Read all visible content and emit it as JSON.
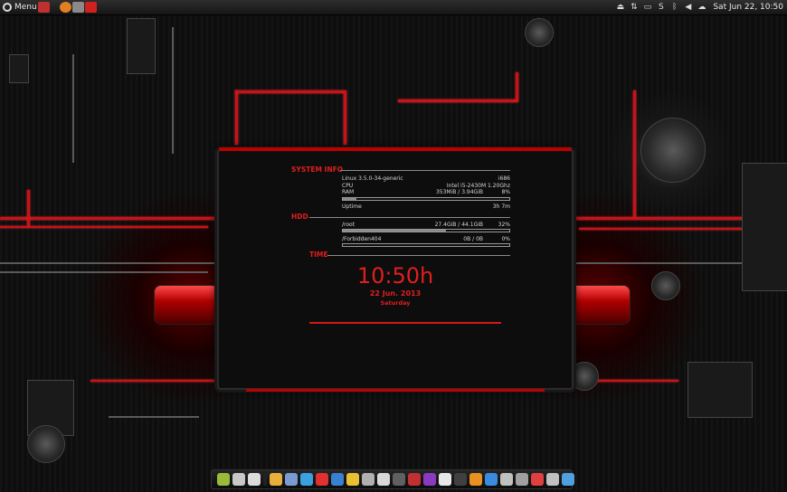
{
  "panel": {
    "menu_label": "Menu",
    "clock": "Sat Jun 22, 10:50",
    "tray_icons": [
      "eject-icon",
      "arrow-up-icon",
      "battery-icon",
      "skype-icon",
      "bluetooth-icon",
      "volume-icon",
      "weather-icon"
    ]
  },
  "conky": {
    "system_info": {
      "title": "SYSTEM INFO",
      "kernel": "Linux 3.5.0-34-generic",
      "arch": "i686",
      "cpu_label": "CPU",
      "cpu_value": "Intel i5-2430M 1.20Ghz",
      "ram_label": "RAM",
      "ram_usage": "353MiB / 3.94GiB",
      "ram_percent": "8%",
      "ram_fraction": 0.08,
      "uptime_label": "Uptime",
      "uptime_value": "3h 7m"
    },
    "hdd": {
      "title": "HDD",
      "drives": [
        {
          "name": "/root",
          "usage": "27.4GiB / 44.1GiB",
          "percent": "32%",
          "fraction": 0.62
        },
        {
          "name": "/Forbidden404",
          "usage": "0B / 0B",
          "percent": "0%",
          "fraction": 0.0
        }
      ]
    },
    "time": {
      "title": "TIME",
      "clock": "10:50h",
      "date": "22 Jun. 2013",
      "day": "Saturday"
    }
  },
  "colors": {
    "accent": "#e01e1e",
    "panel_bg": "#1e1e1e",
    "conky_bg": "#0d0d0d"
  },
  "dock": {
    "items": [
      {
        "icon": "android-icon",
        "color": "#9aba3a"
      },
      {
        "icon": "tools-icon",
        "color": "#c8c8c8"
      },
      {
        "icon": "mail-icon",
        "color": "#dcdcdc"
      },
      {
        "icon": "separator-icon",
        "color": "#222222"
      },
      {
        "icon": "game-icon",
        "color": "#e8b03a"
      },
      {
        "icon": "pen-icon",
        "color": "#7a9ad0"
      },
      {
        "icon": "twitter-icon",
        "color": "#3aa0e0"
      },
      {
        "icon": "bookmark-icon",
        "color": "#e03030"
      },
      {
        "icon": "arrow-icon",
        "color": "#3a80d0"
      },
      {
        "icon": "chrome-icon",
        "color": "#e8c030"
      },
      {
        "icon": "camera-icon",
        "color": "#b0b0b0"
      },
      {
        "icon": "box-icon",
        "color": "#d8d8d8"
      },
      {
        "icon": "terminal-icon",
        "color": "#606060"
      },
      {
        "icon": "music-icon",
        "color": "#c03030"
      },
      {
        "icon": "paint-icon",
        "color": "#8a3ac0"
      },
      {
        "icon": "bag-icon",
        "color": "#e8e8e8"
      },
      {
        "icon": "tv-icon",
        "color": "#404040"
      },
      {
        "icon": "x-icon",
        "color": "#e89020"
      },
      {
        "icon": "plane-icon",
        "color": "#3a8ae0"
      },
      {
        "icon": "search-icon",
        "color": "#c0c0c0"
      },
      {
        "icon": "trash-icon",
        "color": "#a0a0a0"
      },
      {
        "icon": "cleaner-icon",
        "color": "#e04040"
      },
      {
        "icon": "audio-icon",
        "color": "#c0c0c0"
      },
      {
        "icon": "gift-icon",
        "color": "#50a0e0"
      }
    ]
  }
}
